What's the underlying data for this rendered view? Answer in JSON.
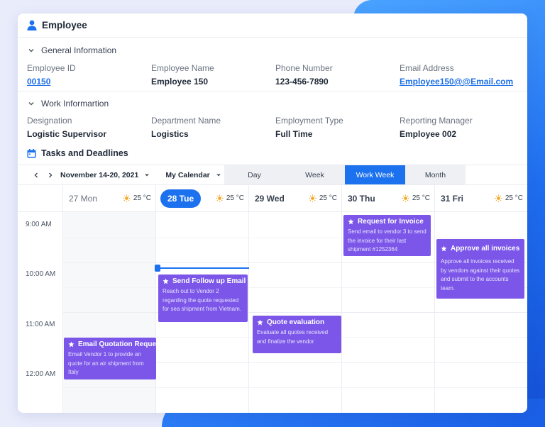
{
  "header": {
    "title": "Employee",
    "icon": "person-icon"
  },
  "general": {
    "section_title": "General Information",
    "fields": [
      {
        "label": "Employee ID",
        "value": "00150"
      },
      {
        "label": "Employee Name",
        "value": "Employee 150"
      },
      {
        "label": "Phone Number",
        "value": "123-456-7890"
      },
      {
        "label": "Email Address",
        "value": "Employee150@@Email.com"
      }
    ]
  },
  "work": {
    "section_title": "Work Informartion",
    "fields": [
      {
        "label": "Designation",
        "value": "Logistic Supervisor"
      },
      {
        "label": "Department Name",
        "value": "Logistics"
      },
      {
        "label": "Employment Type",
        "value": "Full Time"
      },
      {
        "label": "Reporting Manager",
        "value": "Employee 002"
      }
    ]
  },
  "tasks": {
    "title": "Tasks and Deadlines",
    "date_range": "November 14-20, 2021",
    "calendar": "My Calendar",
    "views": [
      "Day",
      "Week",
      "Work Week",
      "Month"
    ],
    "active_view": "Work Week",
    "days": [
      {
        "label": "27 Mon",
        "temp": "25 °C"
      },
      {
        "label": "28 Tue",
        "temp": "25 °C"
      },
      {
        "label": "29 Wed",
        "temp": "25 °C"
      },
      {
        "label": "30 Thu",
        "temp": "25 °C"
      },
      {
        "label": "31 Fri",
        "temp": "25 °C"
      }
    ],
    "times": [
      "9:00 AM",
      "10:00 AM",
      "11:00 AM",
      "12:00 AM"
    ],
    "events": [
      {
        "title": "Request for Invoice",
        "desc": "Send email to vendor 3 to send the invoice for their last shipment #1252364"
      },
      {
        "title": "Approve all invoices",
        "desc": "Approve all invoices received by vendors against their quotes and submit to the accounts team."
      },
      {
        "title": "Send Follow up Email",
        "desc": "Reach out to Vendor 2 regarding the quote requested for sea shipment from Vietnam."
      },
      {
        "title": "Quote evaluation",
        "desc": "Evaluate all quotes received and finalize the vendor"
      },
      {
        "title": "Email Quotation Request",
        "desc": "Email Vendor 1 to provide an quote for an air shipment from Italy"
      }
    ]
  },
  "colors": {
    "primary": "#1c72ee",
    "event": "#7b56e8",
    "link": "#1c6fe8"
  }
}
